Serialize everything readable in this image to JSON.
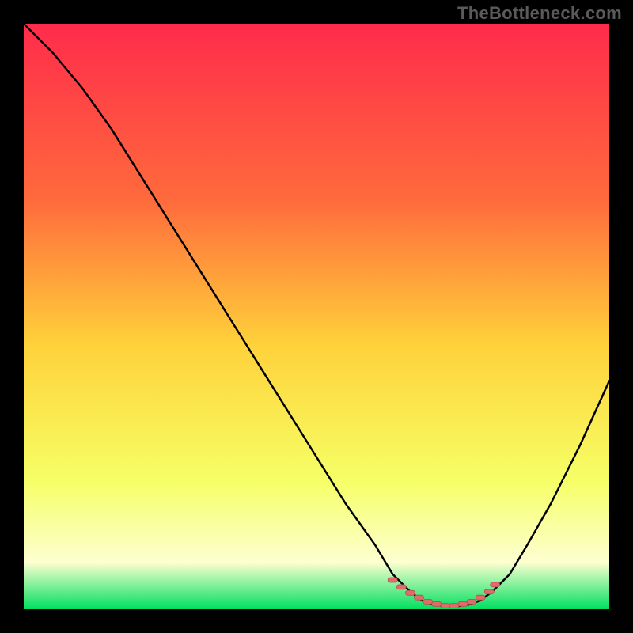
{
  "watermark": "TheBottleneck.com",
  "colors": {
    "page_bg": "#000000",
    "grad_top": "#ff2b4b",
    "grad_mid_upper": "#ff6a3c",
    "grad_mid": "#ffd23a",
    "grad_mid_lower": "#f6ff66",
    "grad_low": "#fdffd0",
    "grad_bottom": "#00e060",
    "curve": "#000000",
    "marker_fill": "#e06b6b",
    "marker_stroke": "#b94d4d"
  },
  "chart_data": {
    "type": "line",
    "title": "",
    "xlabel": "",
    "ylabel": "",
    "xlim": [
      0,
      100
    ],
    "ylim": [
      0,
      100
    ],
    "series": [
      {
        "name": "bottleneck-curve",
        "x": [
          0,
          5,
          10,
          15,
          20,
          25,
          30,
          35,
          40,
          45,
          50,
          55,
          60,
          63,
          66,
          68,
          70,
          72,
          74,
          76,
          78,
          80,
          83,
          86,
          90,
          95,
          100
        ],
        "values": [
          100,
          95,
          89,
          82,
          74,
          66,
          58,
          50,
          42,
          34,
          26,
          18,
          11,
          6,
          3,
          1.5,
          0.8,
          0.5,
          0.5,
          0.8,
          1.5,
          3,
          6,
          11,
          18,
          28,
          39
        ]
      }
    ],
    "optimal_markers": {
      "name": "optimal-zone",
      "x_range": [
        63,
        80
      ],
      "x": [
        63,
        64.5,
        66,
        67.5,
        69,
        70.5,
        72,
        73.5,
        75,
        76.5,
        78,
        79.5,
        80.5
      ],
      "values": [
        5,
        3.8,
        2.8,
        2,
        1.3,
        0.9,
        0.6,
        0.6,
        0.9,
        1.3,
        2,
        3,
        4.2
      ]
    }
  }
}
